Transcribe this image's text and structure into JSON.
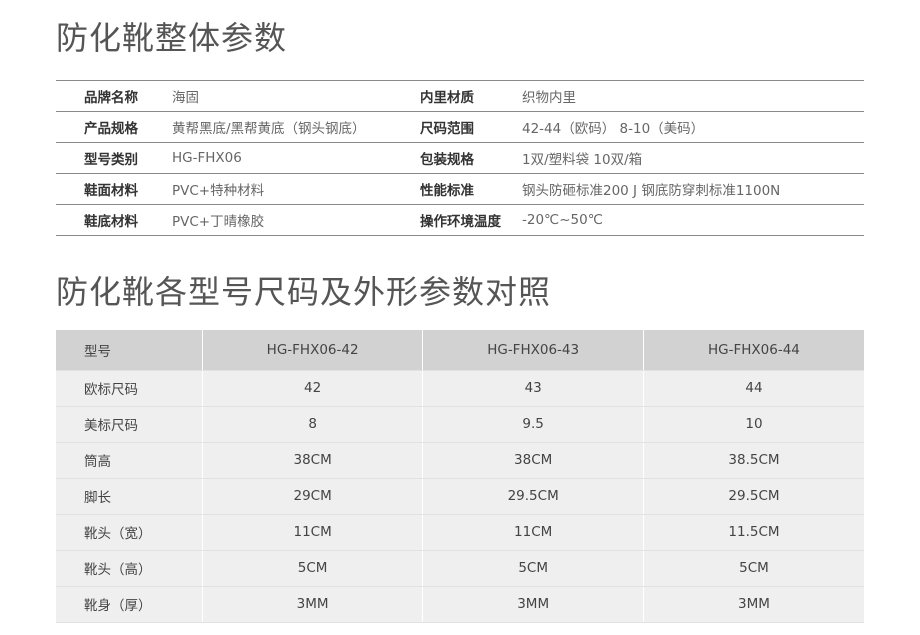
{
  "titles": {
    "overall": "防化靴整体参数",
    "sizes": "防化靴各型号尺码及外形参数对照"
  },
  "spec": [
    {
      "l1": "品牌名称",
      "v1": "海固",
      "l2": "内里材质",
      "v2": "织物内里"
    },
    {
      "l1": "产品规格",
      "v1": "黄帮黑底/黑帮黄底（钢头钢底）",
      "l2": "尺码范围",
      "v2": "42-44（欧码） 8-10（美码）"
    },
    {
      "l1": "型号类别",
      "v1": "HG-FHX06",
      "l2": "包装规格",
      "v2": "1双/塑料袋  10双/箱"
    },
    {
      "l1": "鞋面材料",
      "v1": "PVC+特种材料",
      "l2": "性能标准",
      "v2": "钢头防砸标准200 J   钢底防穿刺标准1100N"
    },
    {
      "l1": "鞋底材料",
      "v1": "PVC+丁晴橡胶",
      "l2": "操作环境温度",
      "v2": "-20℃~50℃"
    }
  ],
  "size_table": {
    "header": [
      "型号",
      "HG-FHX06-42",
      "HG-FHX06-43",
      "HG-FHX06-44"
    ],
    "rows": [
      [
        "欧标尺码",
        "42",
        "43",
        "44"
      ],
      [
        "美标尺码",
        "8",
        "9.5",
        "10"
      ],
      [
        "筒高",
        "38CM",
        "38CM",
        "38.5CM"
      ],
      [
        "脚长",
        "29CM",
        "29.5CM",
        "29.5CM"
      ],
      [
        "靴头（宽）",
        "11CM",
        "11CM",
        "11.5CM"
      ],
      [
        "靴头（高）",
        "5CM",
        "5CM",
        "5CM"
      ],
      [
        "靴身（厚）",
        "3MM",
        "3MM",
        "3MM"
      ]
    ]
  }
}
